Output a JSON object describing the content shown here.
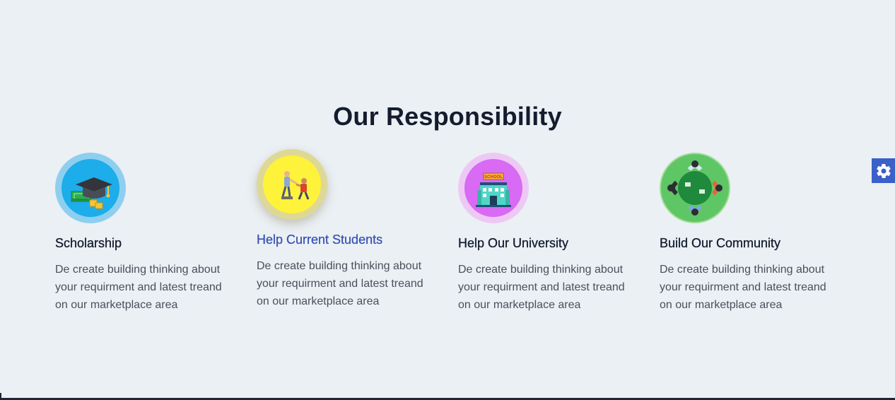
{
  "section": {
    "title": "Our Responsibility"
  },
  "cards": [
    {
      "title": "Scholarship",
      "description": "De create building thinking about your requirment and latest treand on our marketplace area",
      "icon": "graduation-cap-icon",
      "ring_color": "#8ecff0",
      "inner_color": "#1cadea"
    },
    {
      "title": "Help Current Students",
      "description": "De create building thinking about your requirment and latest treand on our marketplace area",
      "icon": "helping-students-icon",
      "ring_color": "#ddd995",
      "inner_color": "#fff23a"
    },
    {
      "title": "Help Our University",
      "description": "De create building thinking about your requirment and latest treand on our marketplace area",
      "icon": "school-building-icon",
      "icon_text": "SCHOOL",
      "ring_color": "#eec8f5",
      "inner_color": "#d86af3"
    },
    {
      "title": "Build Our Community",
      "description": "De create building thinking about your requirment and latest treand on our marketplace area",
      "icon": "community-table-icon",
      "ring_color": "#a3dd96",
      "inner_color": "#5fc665"
    }
  ],
  "settings": {
    "icon": "gear-icon",
    "color": "#3a60c9"
  },
  "colors": {
    "background": "#ebf0f5",
    "title": "#141c2e",
    "accent": "#3a55b4"
  }
}
